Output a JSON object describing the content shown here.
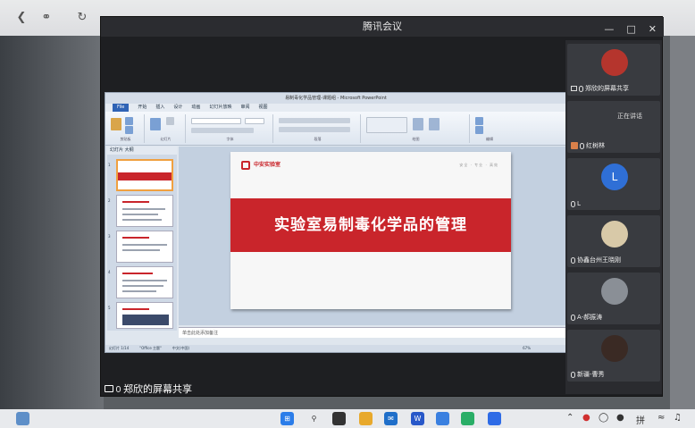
{
  "meeting": {
    "window_title": "腾讯会议",
    "minimize": "—",
    "maximize": "□",
    "close": "✕",
    "share_label": "郑欣的屏幕共享"
  },
  "ppt": {
    "window_title": "易制毒化学品管理-课题组 - Microsoft PowerPoint",
    "tabs": [
      "File",
      "开始",
      "插入",
      "设计",
      "动画",
      "幻灯片放映",
      "审阅",
      "视图"
    ],
    "ribbon_groups": [
      "剪贴板",
      "幻灯片",
      "字体",
      "段落",
      "绘图",
      "编辑"
    ],
    "thumb_tabs": "幻灯片   大纲",
    "thumb_numbers": [
      "1",
      "2",
      "3",
      "4",
      "5"
    ],
    "slide": {
      "logo_text": "中安实验室",
      "tagline": "安全 · 专业 · 高效",
      "title": "实验室易制毒化学品的管理"
    },
    "notes_placeholder": "单击此处添加备注",
    "status": {
      "slide_count": "幻灯片 1/14",
      "theme": "\"Office 主题\"",
      "language": "中文(中国)",
      "zoom": "67%"
    }
  },
  "participants": [
    {
      "name": "郑欣的屏幕共享",
      "avatar_color": "#b5352d",
      "type": "logo"
    },
    {
      "name": "红树林",
      "status": "正在讲话",
      "type": "speaking"
    },
    {
      "name": "L",
      "avatar_letter": "L",
      "avatar_color": "#2f6fd6",
      "type": "letter"
    },
    {
      "name": "协鑫台州王晓刚",
      "avatar_color": "#d8c9a8",
      "type": "photo"
    },
    {
      "name": "A-郝振涛",
      "avatar_color": "#8a8f96",
      "type": "photo"
    },
    {
      "name": "新疆-曹秀",
      "avatar_color": "#3a2a24",
      "type": "photo"
    }
  ],
  "taskbar": {
    "ime_label": "拼",
    "apps": [
      {
        "name": "start",
        "color": "#2b7de9"
      },
      {
        "name": "search",
        "color": "#333333"
      },
      {
        "name": "task-view",
        "color": "#333333"
      },
      {
        "name": "file-explorer",
        "color": "#e8a92c"
      },
      {
        "name": "mail",
        "color": "#1f6fc9"
      },
      {
        "name": "wps",
        "color": "#2858c9"
      },
      {
        "name": "feishu",
        "color": "#3a80e0"
      },
      {
        "name": "wechat",
        "color": "#2aae67"
      },
      {
        "name": "tencent-meeting",
        "color": "#2e6be6"
      }
    ]
  }
}
